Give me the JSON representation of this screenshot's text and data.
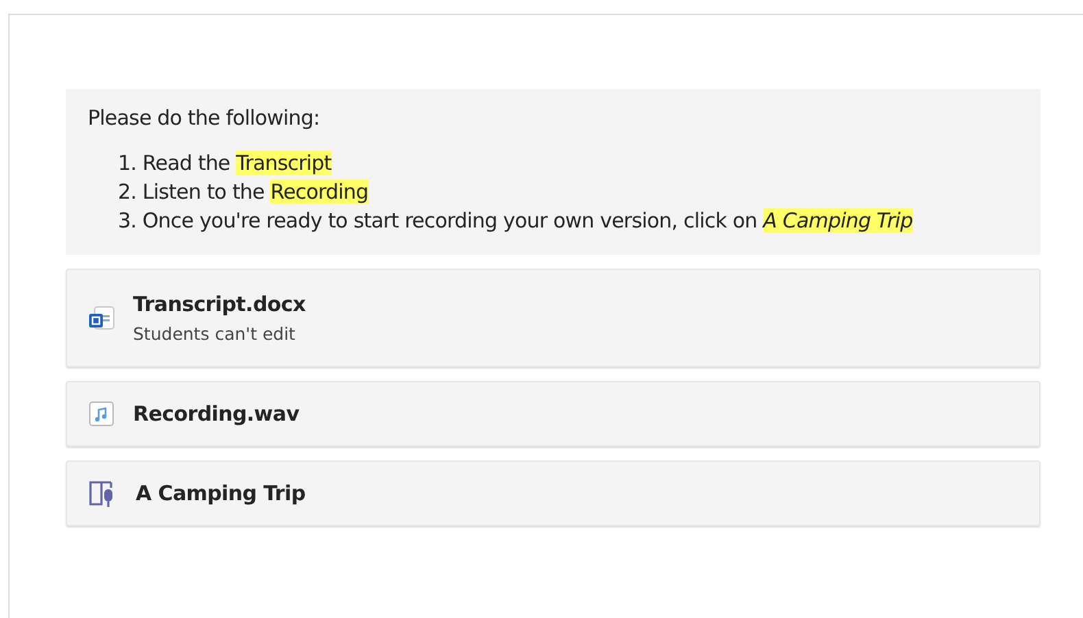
{
  "instructions": {
    "intro": "Please do the following:",
    "steps": [
      {
        "number": "1.",
        "parts": [
          {
            "text": "Read the ",
            "highlighted": false
          },
          {
            "text": "Transcript",
            "highlighted": true
          }
        ]
      },
      {
        "number": "2.",
        "parts": [
          {
            "text": "Listen to the ",
            "highlighted": false
          },
          {
            "text": "Recording",
            "highlighted": true
          }
        ]
      },
      {
        "number": "3.",
        "parts": [
          {
            "text": "Once you're ready to start recording your own version, click on ",
            "highlighted": false
          },
          {
            "text": "*A Camping Trip*",
            "highlighted": true
          }
        ]
      }
    ]
  },
  "attachments": [
    {
      "kind": "word",
      "name": "Transcript.docx",
      "subtitle": "Students can't edit"
    },
    {
      "kind": "audio",
      "name": "Recording.wav"
    },
    {
      "kind": "reading",
      "name": "A Camping Trip"
    }
  ]
}
